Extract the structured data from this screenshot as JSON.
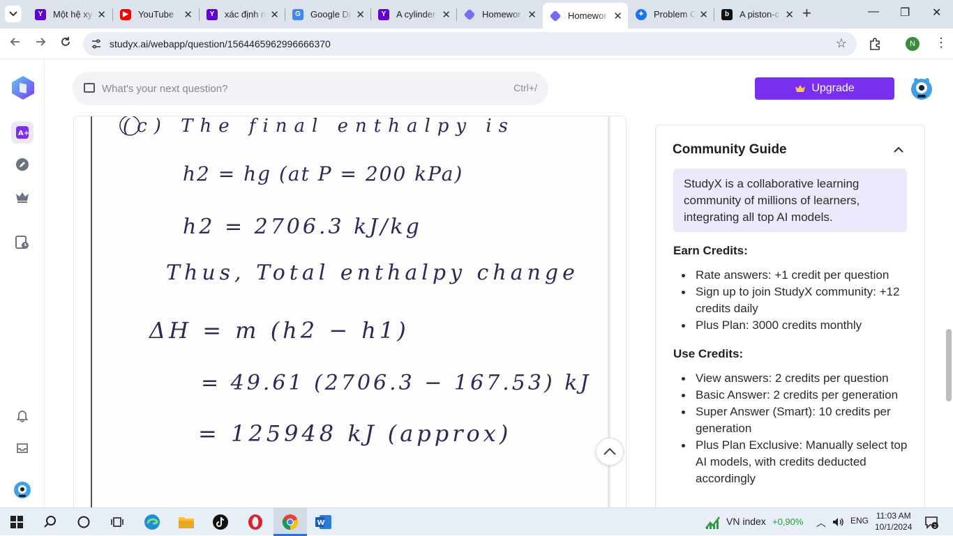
{
  "browser": {
    "tabs": [
      {
        "title": "Một hệ xy",
        "icon": "yahoo-icon",
        "color": "#6001d2"
      },
      {
        "title": "YouTube",
        "icon": "youtube-icon",
        "color": "#ff0000"
      },
      {
        "title": "xác định n",
        "icon": "yahoo-icon",
        "color": "#6001d2"
      },
      {
        "title": "Google Dị",
        "icon": "google-translate-icon",
        "color": "#4285f4"
      },
      {
        "title": "A cylinder",
        "icon": "yahoo-icon",
        "color": "#6001d2"
      },
      {
        "title": "Homewor",
        "icon": "studyx-icon",
        "color": "#7a6cf0"
      },
      {
        "title": "Homewor",
        "icon": "studyx-icon",
        "color": "#7a6cf0"
      },
      {
        "title": "Problem C",
        "icon": "problem-icon",
        "color": "#1a73e8"
      },
      {
        "title": "A piston-c",
        "icon": "bartleby-icon",
        "color": "#111111"
      }
    ],
    "active_tab": 6,
    "url": "studyx.ai/webapp/question/1564465962996666370"
  },
  "app": {
    "search": {
      "placeholder": "What's your next question?",
      "shortcut": "Ctrl+/"
    },
    "upgrade_label": "Upgrade",
    "answer_image": {
      "lines": [
        "(c) The final enthalpy is",
        "h2 = hg (at P = 200 kPa)",
        "h2 = 2706.3 kJ/kg",
        "Thus, Total enthalpy change",
        "ΔH = m (h2 − h1)",
        "= 49.61 (2706.3 − 167.53) kJ",
        "= 125948 kJ (approx)"
      ]
    },
    "community_guide": {
      "title": "Community Guide",
      "intro": "StudyX is a collaborative learning community of millions of learners, integrating all top AI models.",
      "earn_title": "Earn Credits:",
      "earn_items": [
        "Rate answers: +1 credit per question",
        "Sign up to join StudyX community: +12 credits daily",
        "Plus Plan: 3000 credits monthly"
      ],
      "use_title": "Use Credits:",
      "use_items": [
        "View answers: 2 credits per question",
        "Basic Answer: 2 credits per generation",
        "Super Answer (Smart): 10 credits per generation",
        "Plus Plan Exclusive: Manually select top AI models, with credits deducted accordingly"
      ]
    }
  },
  "taskbar": {
    "stock_name": "VN index",
    "stock_change": "+0,90%",
    "language": "ENG",
    "time": "11:03 AM",
    "date": "10/1/2024"
  }
}
